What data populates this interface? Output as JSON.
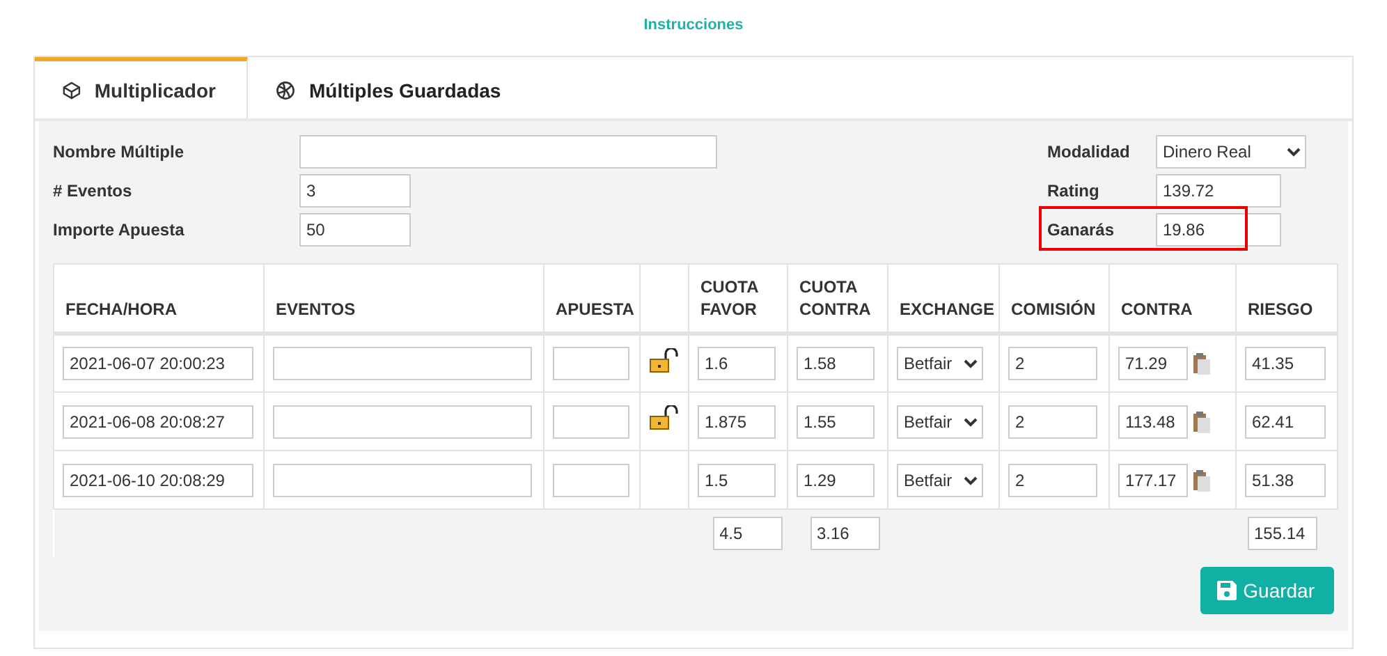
{
  "header_link": "Instrucciones",
  "tabs": [
    {
      "label": "Multiplicador",
      "selected": true
    },
    {
      "label": "Múltiples Guardadas",
      "selected": false
    }
  ],
  "form_left": [
    {
      "label": "Nombre Múltiple"
    },
    {
      "label": "# Eventos",
      "value": "3"
    },
    {
      "label": "Importe Apuesta",
      "value": "50"
    }
  ],
  "form_right": [
    {
      "label": "Modalidad",
      "kind": "select",
      "value": "Dinero Real",
      "highlighted": false
    },
    {
      "label": "Rating",
      "kind": "text",
      "value": "139.72",
      "highlighted": false
    },
    {
      "label": "Ganarás",
      "kind": "text",
      "value": "19.86",
      "highlighted": true
    }
  ],
  "table": {
    "columns": [
      "FECHA/HORA",
      "EVENTOS",
      "APUESTA",
      "",
      "CUOTA FAVOR",
      "CUOTA CONTRA",
      "EXCHANGE",
      "COMISIÓN",
      "CONTRA",
      "RIESGO"
    ],
    "rows": [
      {
        "fecha": "2021-06-07 20:00:23",
        "locked": true,
        "cuota_favor": "1.6",
        "cuota_contra": "1.58",
        "exchange": "Betfair",
        "comision": "2",
        "contra": "71.29",
        "riesgo": "41.35"
      },
      {
        "fecha": "2021-06-08 20:08:27",
        "locked": true,
        "cuota_favor": "1.875",
        "cuota_contra": "1.55",
        "exchange": "Betfair",
        "comision": "2",
        "contra": "113.48",
        "riesgo": "62.41"
      },
      {
        "fecha": "2021-06-10 20:08:29",
        "locked": false,
        "cuota_favor": "1.5",
        "cuota_contra": "1.29",
        "exchange": "Betfair",
        "comision": "2",
        "contra": "177.17",
        "riesgo": "51.38"
      }
    ],
    "totals": {
      "cuota_favor": "4.5",
      "cuota_contra": "3.16",
      "riesgo": "155.14"
    }
  },
  "save_button": "Guardar"
}
